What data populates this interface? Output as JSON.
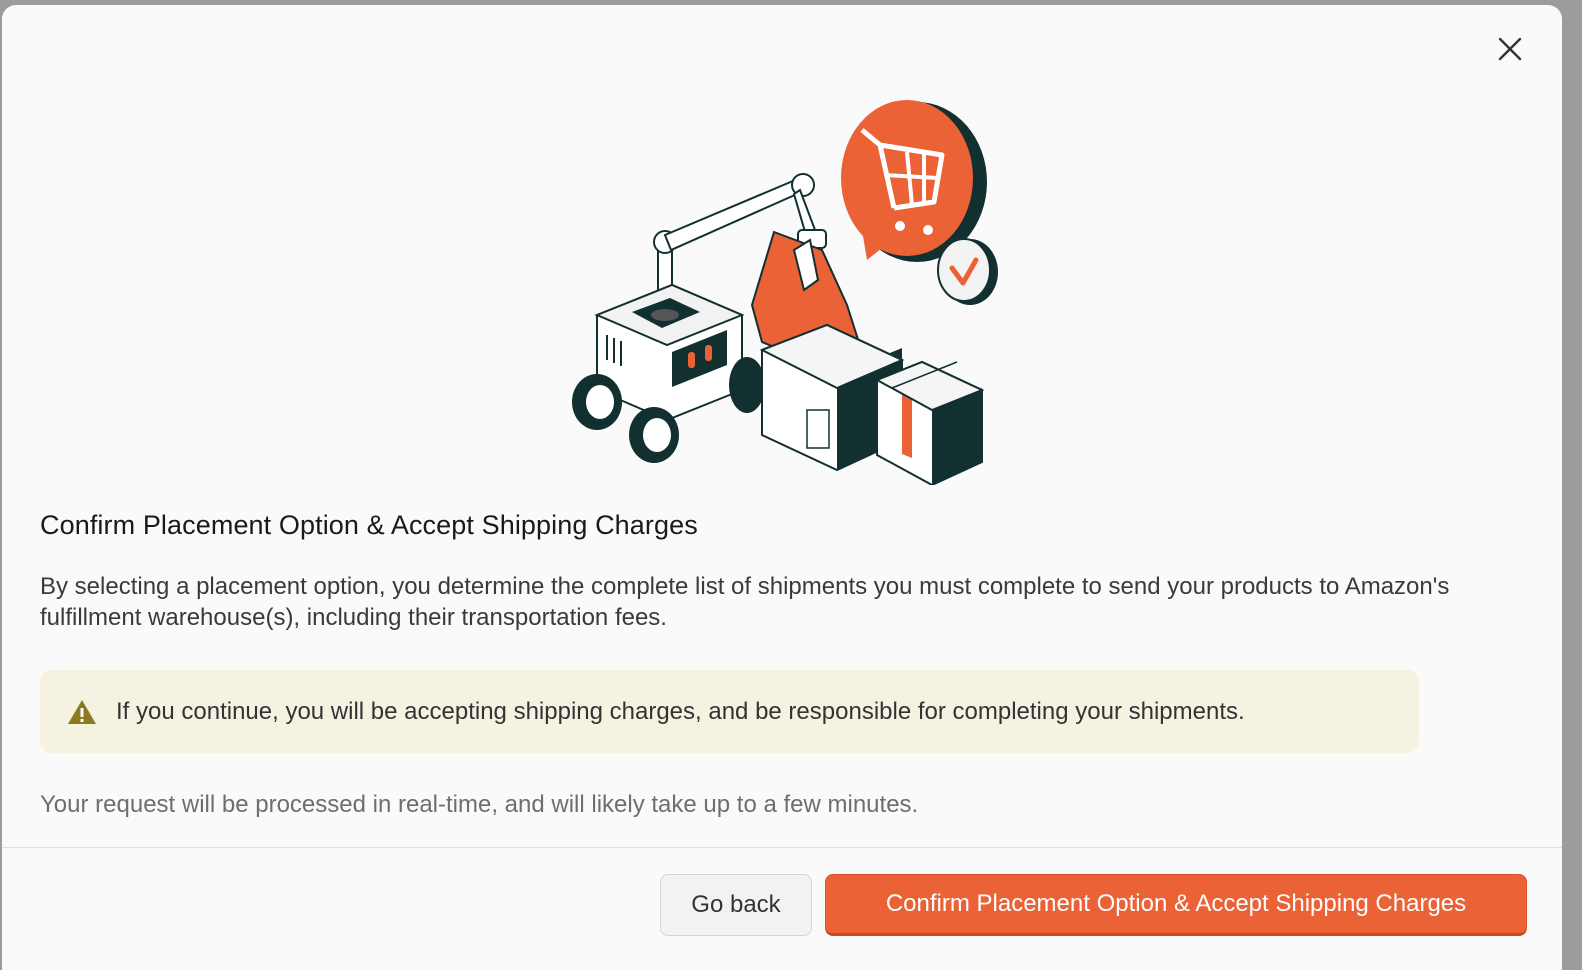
{
  "dialog": {
    "title": "Confirm Placement Option & Accept Shipping Charges",
    "description": "By selecting a placement option, you determine the complete list of shipments you must complete to send your products to Amazon's fulfillment warehouse(s), including their transportation fees.",
    "warning": "If you continue, you will be accepting shipping charges, and be responsible for completing your shipments.",
    "note": "Your request will be processed in real-time, and will likely take up to a few minutes.",
    "icons": {
      "close": "close-icon",
      "warning": "warning-triangle-icon",
      "illustration": "robot-packing-boxes-illustration"
    }
  },
  "footer": {
    "back_label": "Go back",
    "confirm_label": "Confirm Placement Option & Accept Shipping Charges"
  },
  "colors": {
    "accent": "#ea6236",
    "warning_bg": "#f5f2e2",
    "warning_icon": "#8a7a20",
    "dark_teal": "#123030"
  }
}
